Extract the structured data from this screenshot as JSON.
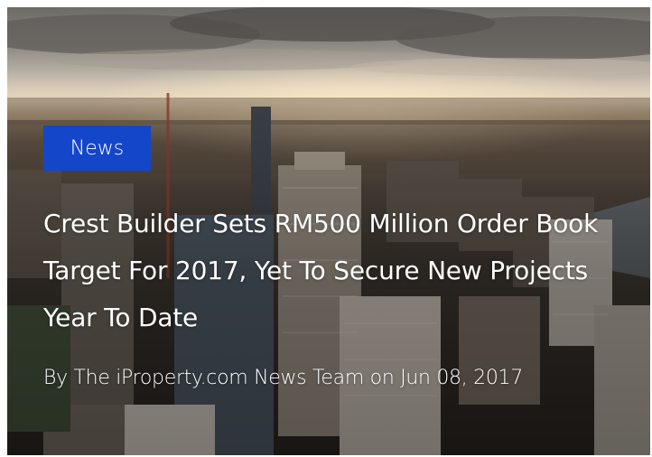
{
  "article": {
    "category": "News",
    "title": "Crest Builder Sets RM500 Million Order Book Target For 2017, Yet To Secure New Projects Year To Date",
    "byline_prefix": "By ",
    "author": "The iProperty.com News Team",
    "byline_sep": " on ",
    "date": "Jun 08, 2017"
  },
  "colors": {
    "badge": "#1446c9",
    "text": "#ffffff"
  }
}
